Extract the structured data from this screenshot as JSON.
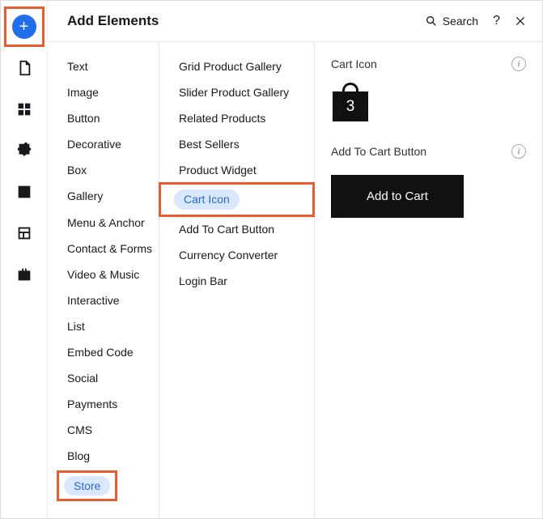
{
  "header": {
    "title": "Add Elements",
    "search_label": "Search"
  },
  "rail": {
    "add": "+"
  },
  "categories": [
    "Text",
    "Image",
    "Button",
    "Decorative",
    "Box",
    "Gallery",
    "Menu & Anchor",
    "Contact & Forms",
    "Video & Music",
    "Interactive",
    "List",
    "Embed Code",
    "Social",
    "Payments",
    "CMS",
    "Blog",
    "Store"
  ],
  "subcategories": [
    "Grid Product Gallery",
    "Slider Product Gallery",
    "Related Products",
    "Best Sellers",
    "Product Widget",
    "Cart Icon",
    "Add To Cart Button",
    "Currency Converter",
    "Login Bar"
  ],
  "preview": {
    "section1_title": "Cart Icon",
    "cart_count": "3",
    "section2_title": "Add To Cart Button",
    "button_label": "Add to Cart"
  }
}
